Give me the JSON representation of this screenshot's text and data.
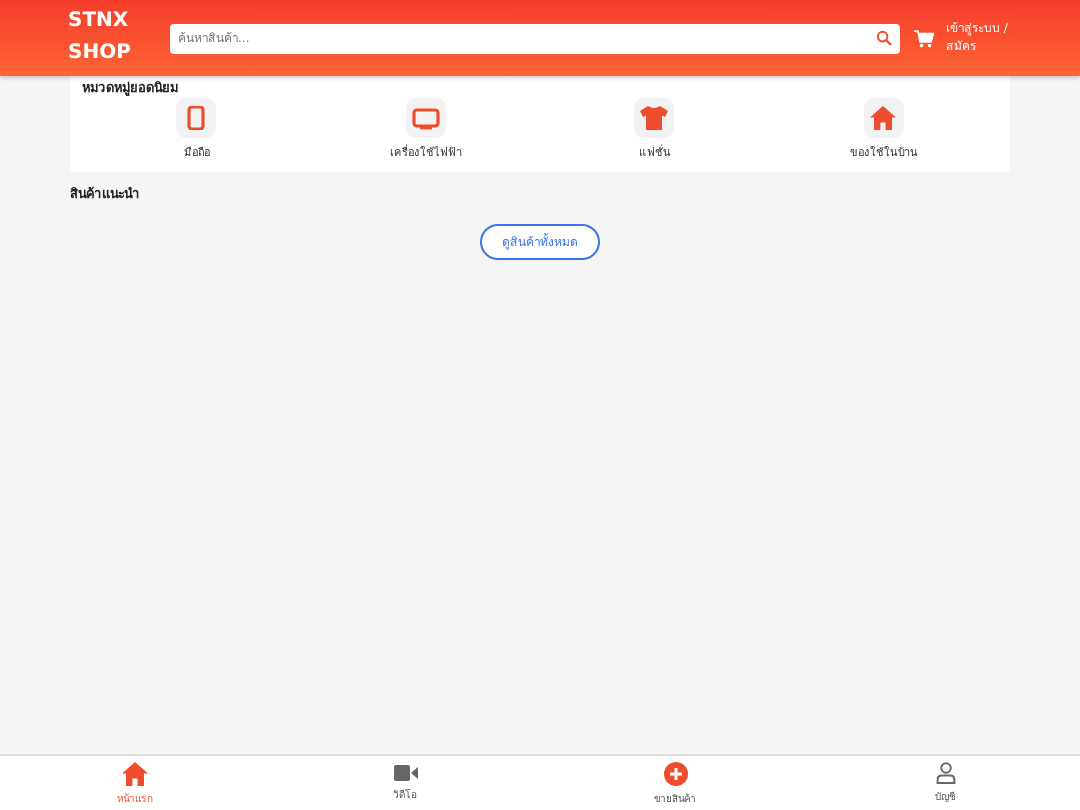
{
  "header": {
    "logo": "STNX SHOP",
    "search": {
      "placeholder": "ค้นหาสินค้า..."
    },
    "login": "เข้าสู่ระบบ / สมัคร"
  },
  "categories": {
    "title": "หมวดหมู่ยอดนิยม",
    "items": [
      {
        "label": "มือถือ",
        "kind": "phone"
      },
      {
        "label": "เครื่องใช้ไฟฟ้า",
        "kind": "tv"
      },
      {
        "label": "แฟชั่น",
        "kind": "shirt"
      },
      {
        "label": "ของใช้ในบ้าน",
        "kind": "home"
      }
    ]
  },
  "recommended": {
    "title": "สินค้าแนะนำ",
    "button": "ดูสินค้าทั้งหมด"
  },
  "bottom_nav": [
    {
      "label": "หน้าแรก",
      "kind": "home",
      "selected": true
    },
    {
      "label": "วิดีโอ",
      "kind": "video",
      "selected": false
    },
    {
      "label": "ขายสินค้า",
      "kind": "sell",
      "selected": false
    },
    {
      "label": "บัญชี",
      "kind": "account",
      "selected": false
    }
  ]
}
